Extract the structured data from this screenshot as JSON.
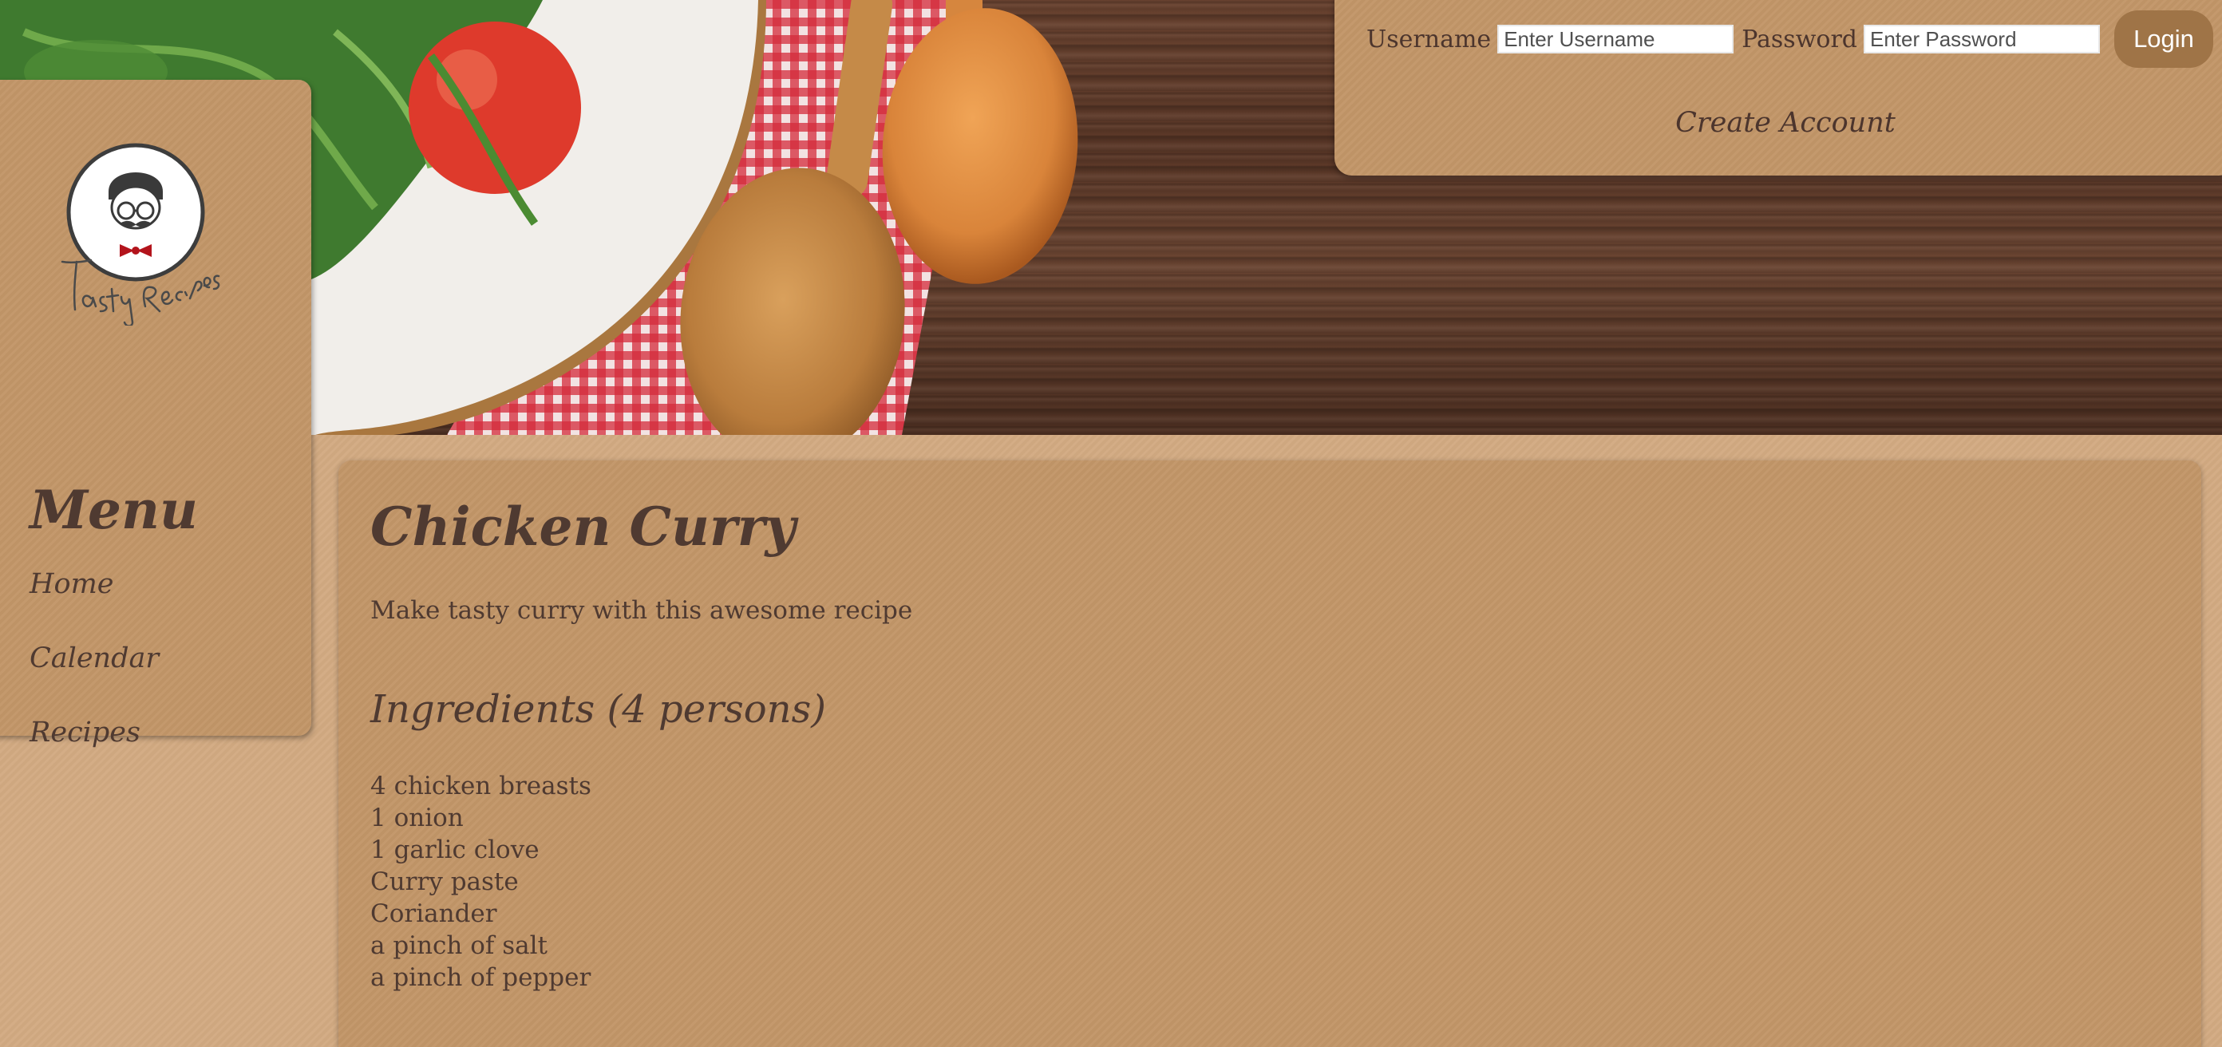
{
  "login": {
    "username_label": "Username",
    "username_placeholder": "Enter Username",
    "password_label": "Password",
    "password_placeholder": "Enter Password",
    "login_button": "Login",
    "create_account": "Create Account"
  },
  "sidebar": {
    "logo_text": "Tasty Recipes",
    "menu_heading": "Menu",
    "items": [
      {
        "label": "Home"
      },
      {
        "label": "Calendar"
      },
      {
        "label": "Recipes"
      }
    ]
  },
  "recipe": {
    "title": "Chicken Curry",
    "description": "Make tasty curry with this awesome recipe",
    "ingredients_heading": "Ingredients (4 persons)",
    "ingredients": [
      "4 chicken breasts",
      "1 onion",
      "1 garlic clove",
      "Curry paste",
      "Coriander",
      "a pinch of salt",
      "a pinch of pepper"
    ]
  },
  "colors": {
    "page_background": "#d2aa82",
    "panel": "#c29668",
    "text": "#4f3a31",
    "login_button": "#9f7447"
  },
  "icons": {
    "logo": "chef-mustache-logo-icon"
  }
}
